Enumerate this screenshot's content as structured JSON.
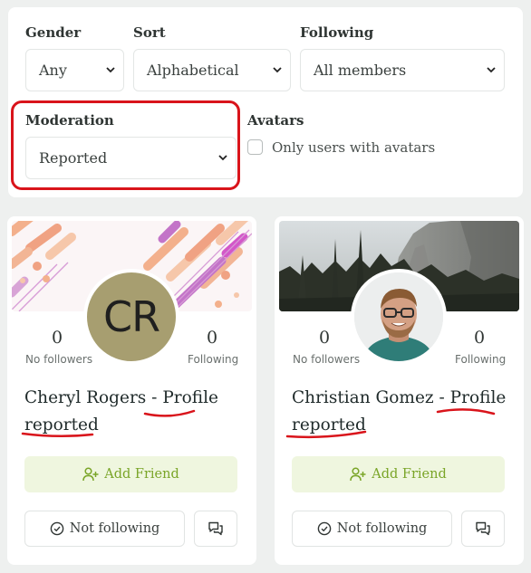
{
  "filters": {
    "gender": {
      "label": "Gender",
      "value": "Any"
    },
    "sort": {
      "label": "Sort",
      "value": "Alphabetical"
    },
    "following": {
      "label": "Following",
      "value": "All members"
    },
    "moderation": {
      "label": "Moderation",
      "value": "Reported"
    },
    "avatars": {
      "label": "Avatars",
      "checkbox_label": "Only users with avatars",
      "checked": false
    }
  },
  "members": [
    {
      "name_part1": "Cheryl Rogers - ",
      "name_part2": "Profile",
      "name_part3": "reported",
      "avatar_initials": "CR",
      "followers_count": "0",
      "followers_label": "No followers",
      "following_count": "0",
      "following_label": "Following",
      "add_friend_label": "Add Friend",
      "follow_status_label": "Not following"
    },
    {
      "name_part1": "Christian Gomez - ",
      "name_part2": "Profile",
      "name_part3": "reported",
      "avatar_initials": "",
      "followers_count": "0",
      "followers_label": "No followers",
      "following_count": "0",
      "following_label": "Following",
      "add_friend_label": "Add Friend",
      "follow_status_label": "Not following"
    }
  ],
  "colors": {
    "annotation_red": "#d9141b",
    "accent_green": "#7aa528",
    "add_friend_bg": "#eff6df",
    "avatar_initials_bg": "#a79e70"
  }
}
